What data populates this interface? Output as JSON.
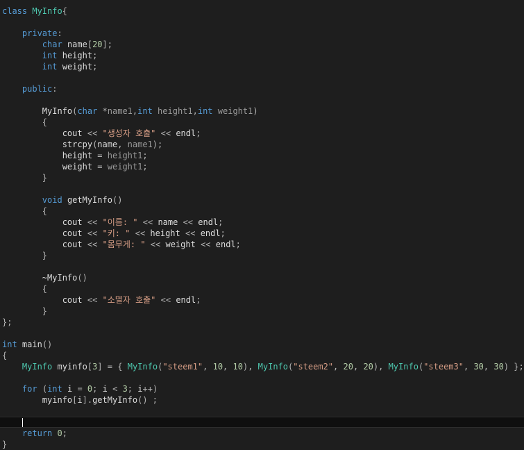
{
  "colors": {
    "background": "#1e1e1e",
    "keyword": "#569cd6",
    "type": "#4ec9b0",
    "string": "#d69d85",
    "number": "#b5cea8",
    "parameter": "#9a9a9a",
    "default": "#dcdcdc"
  },
  "editor": {
    "cursor_line": 37,
    "lines": [
      [
        [
          "kw",
          "class"
        ],
        [
          "ws",
          " "
        ],
        [
          "type",
          "MyInfo"
        ],
        [
          "punc",
          "{"
        ]
      ],
      [],
      [
        [
          "ws",
          "    "
        ],
        [
          "kw",
          "private"
        ],
        [
          "punc",
          ":"
        ]
      ],
      [
        [
          "ws",
          "        "
        ],
        [
          "kw",
          "char"
        ],
        [
          "ws",
          " "
        ],
        [
          "id",
          "name"
        ],
        [
          "punc",
          "["
        ],
        [
          "num",
          "20"
        ],
        [
          "punc",
          "];"
        ]
      ],
      [
        [
          "ws",
          "        "
        ],
        [
          "kw",
          "int"
        ],
        [
          "ws",
          " "
        ],
        [
          "id",
          "height"
        ],
        [
          "punc",
          ";"
        ]
      ],
      [
        [
          "ws",
          "        "
        ],
        [
          "kw",
          "int"
        ],
        [
          "ws",
          " "
        ],
        [
          "id",
          "weight"
        ],
        [
          "punc",
          ";"
        ]
      ],
      [],
      [
        [
          "ws",
          "    "
        ],
        [
          "kw",
          "public"
        ],
        [
          "punc",
          ":"
        ]
      ],
      [],
      [
        [
          "ws",
          "        "
        ],
        [
          "fn",
          "MyInfo"
        ],
        [
          "punc",
          "("
        ],
        [
          "kw",
          "char"
        ],
        [
          "ws",
          " "
        ],
        [
          "op",
          "*"
        ],
        [
          "param",
          "name1"
        ],
        [
          "punc",
          ","
        ],
        [
          "kw",
          "int"
        ],
        [
          "ws",
          " "
        ],
        [
          "param",
          "height1"
        ],
        [
          "punc",
          ","
        ],
        [
          "kw",
          "int"
        ],
        [
          "ws",
          " "
        ],
        [
          "param",
          "weight1"
        ],
        [
          "punc",
          ")"
        ]
      ],
      [
        [
          "ws",
          "        "
        ],
        [
          "punc",
          "{"
        ]
      ],
      [
        [
          "ws",
          "            "
        ],
        [
          "id",
          "cout"
        ],
        [
          "ws",
          " "
        ],
        [
          "op",
          "<<"
        ],
        [
          "ws",
          " "
        ],
        [
          "str",
          "\"생성자 호출\""
        ],
        [
          "ws",
          " "
        ],
        [
          "op",
          "<<"
        ],
        [
          "ws",
          " "
        ],
        [
          "id",
          "endl"
        ],
        [
          "punc",
          ";"
        ]
      ],
      [
        [
          "ws",
          "            "
        ],
        [
          "fn",
          "strcpy"
        ],
        [
          "punc",
          "("
        ],
        [
          "id",
          "name"
        ],
        [
          "punc",
          ","
        ],
        [
          "ws",
          " "
        ],
        [
          "param",
          "name1"
        ],
        [
          "punc",
          ");"
        ]
      ],
      [
        [
          "ws",
          "            "
        ],
        [
          "id",
          "height"
        ],
        [
          "ws",
          " "
        ],
        [
          "op",
          "="
        ],
        [
          "ws",
          " "
        ],
        [
          "param",
          "height1"
        ],
        [
          "punc",
          ";"
        ]
      ],
      [
        [
          "ws",
          "            "
        ],
        [
          "id",
          "weight"
        ],
        [
          "ws",
          " "
        ],
        [
          "op",
          "="
        ],
        [
          "ws",
          " "
        ],
        [
          "param",
          "weight1"
        ],
        [
          "punc",
          ";"
        ]
      ],
      [
        [
          "ws",
          "        "
        ],
        [
          "punc",
          "}"
        ]
      ],
      [],
      [
        [
          "ws",
          "        "
        ],
        [
          "kw",
          "void"
        ],
        [
          "ws",
          " "
        ],
        [
          "fn",
          "getMyInfo"
        ],
        [
          "punc",
          "()"
        ]
      ],
      [
        [
          "ws",
          "        "
        ],
        [
          "punc",
          "{"
        ]
      ],
      [
        [
          "ws",
          "            "
        ],
        [
          "id",
          "cout"
        ],
        [
          "ws",
          " "
        ],
        [
          "op",
          "<<"
        ],
        [
          "ws",
          " "
        ],
        [
          "str",
          "\"이름: \""
        ],
        [
          "ws",
          " "
        ],
        [
          "op",
          "<<"
        ],
        [
          "ws",
          " "
        ],
        [
          "id",
          "name"
        ],
        [
          "ws",
          " "
        ],
        [
          "op",
          "<<"
        ],
        [
          "ws",
          " "
        ],
        [
          "id",
          "endl"
        ],
        [
          "punc",
          ";"
        ]
      ],
      [
        [
          "ws",
          "            "
        ],
        [
          "id",
          "cout"
        ],
        [
          "ws",
          " "
        ],
        [
          "op",
          "<<"
        ],
        [
          "ws",
          " "
        ],
        [
          "str",
          "\"키: \""
        ],
        [
          "ws",
          " "
        ],
        [
          "op",
          "<<"
        ],
        [
          "ws",
          " "
        ],
        [
          "id",
          "height"
        ],
        [
          "ws",
          " "
        ],
        [
          "op",
          "<<"
        ],
        [
          "ws",
          " "
        ],
        [
          "id",
          "endl"
        ],
        [
          "punc",
          ";"
        ]
      ],
      [
        [
          "ws",
          "            "
        ],
        [
          "id",
          "cout"
        ],
        [
          "ws",
          " "
        ],
        [
          "op",
          "<<"
        ],
        [
          "ws",
          " "
        ],
        [
          "str",
          "\"몸무게: \""
        ],
        [
          "ws",
          " "
        ],
        [
          "op",
          "<<"
        ],
        [
          "ws",
          " "
        ],
        [
          "id",
          "weight"
        ],
        [
          "ws",
          " "
        ],
        [
          "op",
          "<<"
        ],
        [
          "ws",
          " "
        ],
        [
          "id",
          "endl"
        ],
        [
          "punc",
          ";"
        ]
      ],
      [
        [
          "ws",
          "        "
        ],
        [
          "punc",
          "}"
        ]
      ],
      [],
      [
        [
          "ws",
          "        "
        ],
        [
          "fn",
          "~MyInfo"
        ],
        [
          "punc",
          "()"
        ]
      ],
      [
        [
          "ws",
          "        "
        ],
        [
          "punc",
          "{"
        ]
      ],
      [
        [
          "ws",
          "            "
        ],
        [
          "id",
          "cout"
        ],
        [
          "ws",
          " "
        ],
        [
          "op",
          "<<"
        ],
        [
          "ws",
          " "
        ],
        [
          "str",
          "\"소멸자 호출\""
        ],
        [
          "ws",
          " "
        ],
        [
          "op",
          "<<"
        ],
        [
          "ws",
          " "
        ],
        [
          "id",
          "endl"
        ],
        [
          "punc",
          ";"
        ]
      ],
      [
        [
          "ws",
          "        "
        ],
        [
          "punc",
          "}"
        ]
      ],
      [
        [
          "punc",
          "};"
        ]
      ],
      [],
      [
        [
          "kw",
          "int"
        ],
        [
          "ws",
          " "
        ],
        [
          "fn",
          "main"
        ],
        [
          "punc",
          "()"
        ]
      ],
      [
        [
          "punc",
          "{"
        ]
      ],
      [
        [
          "ws",
          "    "
        ],
        [
          "type",
          "MyInfo"
        ],
        [
          "ws",
          " "
        ],
        [
          "id",
          "myinfo"
        ],
        [
          "punc",
          "["
        ],
        [
          "num",
          "3"
        ],
        [
          "punc",
          "]"
        ],
        [
          "ws",
          " "
        ],
        [
          "op",
          "="
        ],
        [
          "ws",
          " "
        ],
        [
          "punc",
          "{"
        ],
        [
          "ws",
          " "
        ],
        [
          "type",
          "MyInfo"
        ],
        [
          "punc",
          "("
        ],
        [
          "str",
          "\"steem1\""
        ],
        [
          "punc",
          ","
        ],
        [
          "ws",
          " "
        ],
        [
          "num",
          "10"
        ],
        [
          "punc",
          ","
        ],
        [
          "ws",
          " "
        ],
        [
          "num",
          "10"
        ],
        [
          "punc",
          "),"
        ],
        [
          "ws",
          " "
        ],
        [
          "type",
          "MyInfo"
        ],
        [
          "punc",
          "("
        ],
        [
          "str",
          "\"steem2\""
        ],
        [
          "punc",
          ","
        ],
        [
          "ws",
          " "
        ],
        [
          "num",
          "20"
        ],
        [
          "punc",
          ","
        ],
        [
          "ws",
          " "
        ],
        [
          "num",
          "20"
        ],
        [
          "punc",
          "),"
        ],
        [
          "ws",
          " "
        ],
        [
          "type",
          "MyInfo"
        ],
        [
          "punc",
          "("
        ],
        [
          "str",
          "\"steem3\""
        ],
        [
          "punc",
          ","
        ],
        [
          "ws",
          " "
        ],
        [
          "num",
          "30"
        ],
        [
          "punc",
          ","
        ],
        [
          "ws",
          " "
        ],
        [
          "num",
          "30"
        ],
        [
          "punc",
          ")"
        ],
        [
          "ws",
          " "
        ],
        [
          "punc",
          "};"
        ]
      ],
      [],
      [
        [
          "ws",
          "    "
        ],
        [
          "kw",
          "for"
        ],
        [
          "ws",
          " "
        ],
        [
          "punc",
          "("
        ],
        [
          "kw",
          "int"
        ],
        [
          "ws",
          " "
        ],
        [
          "id",
          "i"
        ],
        [
          "ws",
          " "
        ],
        [
          "op",
          "="
        ],
        [
          "ws",
          " "
        ],
        [
          "num",
          "0"
        ],
        [
          "punc",
          ";"
        ],
        [
          "ws",
          " "
        ],
        [
          "id",
          "i"
        ],
        [
          "ws",
          " "
        ],
        [
          "op",
          "<"
        ],
        [
          "ws",
          " "
        ],
        [
          "num",
          "3"
        ],
        [
          "punc",
          ";"
        ],
        [
          "ws",
          " "
        ],
        [
          "id",
          "i"
        ],
        [
          "op",
          "++"
        ],
        [
          "punc",
          ")"
        ]
      ],
      [
        [
          "ws",
          "        "
        ],
        [
          "id",
          "myinfo"
        ],
        [
          "punc",
          "["
        ],
        [
          "id",
          "i"
        ],
        [
          "punc",
          "]."
        ],
        [
          "fn",
          "getMyInfo"
        ],
        [
          "punc",
          "()"
        ],
        [
          "ws",
          " "
        ],
        [
          "punc",
          ";"
        ]
      ],
      [],
      [
        [
          "ws",
          "    "
        ]
      ],
      [
        [
          "ws",
          "    "
        ],
        [
          "kw",
          "return"
        ],
        [
          "ws",
          " "
        ],
        [
          "num",
          "0"
        ],
        [
          "punc",
          ";"
        ]
      ],
      [
        [
          "punc",
          "}"
        ]
      ]
    ]
  }
}
